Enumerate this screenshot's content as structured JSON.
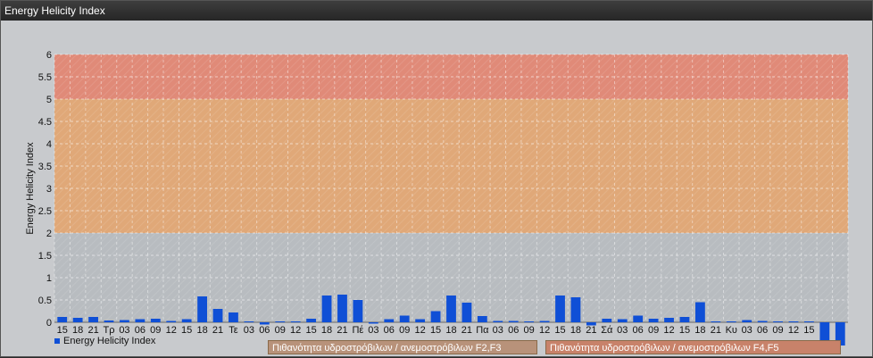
{
  "window": {
    "title": "Energy Helicity Index"
  },
  "legend": {
    "label": "Energy Helicity Index"
  },
  "probability_labels": [
    "Πιθανότητα υδροστρόβιλων / ανεμοστρόβιλων F2,F3",
    "Πιθανότητα υδροστρόβιλων / ανεμοστρόβιλων F4,F5"
  ],
  "chart_data": {
    "type": "bar",
    "title": "",
    "ylabel": "Energy Helicity Index",
    "xlabel": "",
    "ylim": [
      0,
      6
    ],
    "yticks": [
      "0",
      "0.5",
      "1",
      "1.5",
      "2",
      "2.5",
      "3",
      "3.5",
      "4",
      "4.5",
      "5",
      "5.5",
      "6"
    ],
    "grid": true,
    "legend_position": "bottom-left",
    "bands": [
      {
        "from": 0,
        "to": 2,
        "color": "#b8bcc0"
      },
      {
        "from": 2,
        "to": 5,
        "color": "#e0a878"
      },
      {
        "from": 5,
        "to": 6,
        "color": "#e08a78"
      }
    ],
    "bar_color": "#0f4fd6",
    "categories": [
      "15",
      "18",
      "21",
      "Τρ",
      "03",
      "06",
      "09",
      "12",
      "15",
      "18",
      "21",
      "Τε",
      "03",
      "06",
      "09",
      "12",
      "15",
      "18",
      "21",
      "Πέ",
      "03",
      "06",
      "09",
      "12",
      "15",
      "18",
      "21",
      "Πα",
      "03",
      "06",
      "09",
      "12",
      "15",
      "18",
      "21",
      "Σά",
      "03",
      "06",
      "09",
      "12",
      "15",
      "18",
      "21",
      "Κυ",
      "03",
      "06",
      "09",
      "12",
      "15",
      "",
      ""
    ],
    "values": [
      0.12,
      0.1,
      0.12,
      0.04,
      0.05,
      0.07,
      0.08,
      0.03,
      0.07,
      0.58,
      0.3,
      0.22,
      0.02,
      -0.05,
      0.02,
      0.02,
      0.08,
      0.6,
      0.62,
      0.5,
      -0.03,
      0.07,
      0.15,
      0.07,
      0.25,
      0.6,
      0.44,
      0.14,
      0.03,
      0.03,
      0.02,
      0.03,
      0.6,
      0.56,
      -0.07,
      0.08,
      0.07,
      0.15,
      0.08,
      0.1,
      0.12,
      0.45,
      0.02,
      0.02,
      0.05,
      0.03,
      0.02,
      0.02,
      0.02,
      -0.52,
      -0.52
    ]
  }
}
